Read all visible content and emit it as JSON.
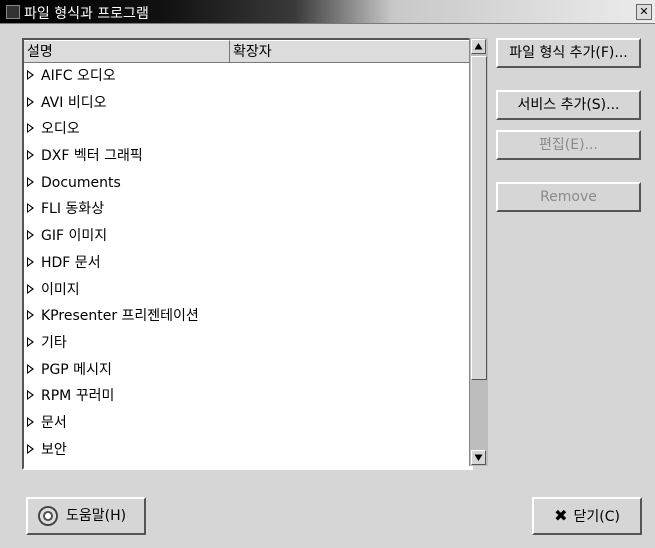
{
  "window": {
    "title": "파일 형식과 프로그램",
    "close_icon": "close-icon"
  },
  "list": {
    "columns": [
      "설명",
      "확장자"
    ],
    "items": [
      "AIFC 오디오",
      "AVI 비디오",
      "오디오",
      "DXF 벡터 그래픽",
      "Documents",
      "FLI 동화상",
      "GIF 이미지",
      "HDF 문서",
      "이미지",
      "KPresenter 프리젠테이션",
      "기타",
      "PGP 메시지",
      "RPM 꾸러미",
      "문서",
      "보안"
    ]
  },
  "buttons": {
    "add_type": "파일 형식 추가(F)...",
    "add_service": "서비스 추가(S)...",
    "edit": "편집(E)...",
    "remove": "Remove",
    "help": "도움말(H)",
    "close": "닫기(C)"
  },
  "icons": {
    "help": "help-lifebuoy-icon",
    "close": "close-x-icon",
    "expander": "expander-triangle-icon",
    "scroll_up": "arrow-up-icon",
    "scroll_down": "arrow-down-icon"
  }
}
